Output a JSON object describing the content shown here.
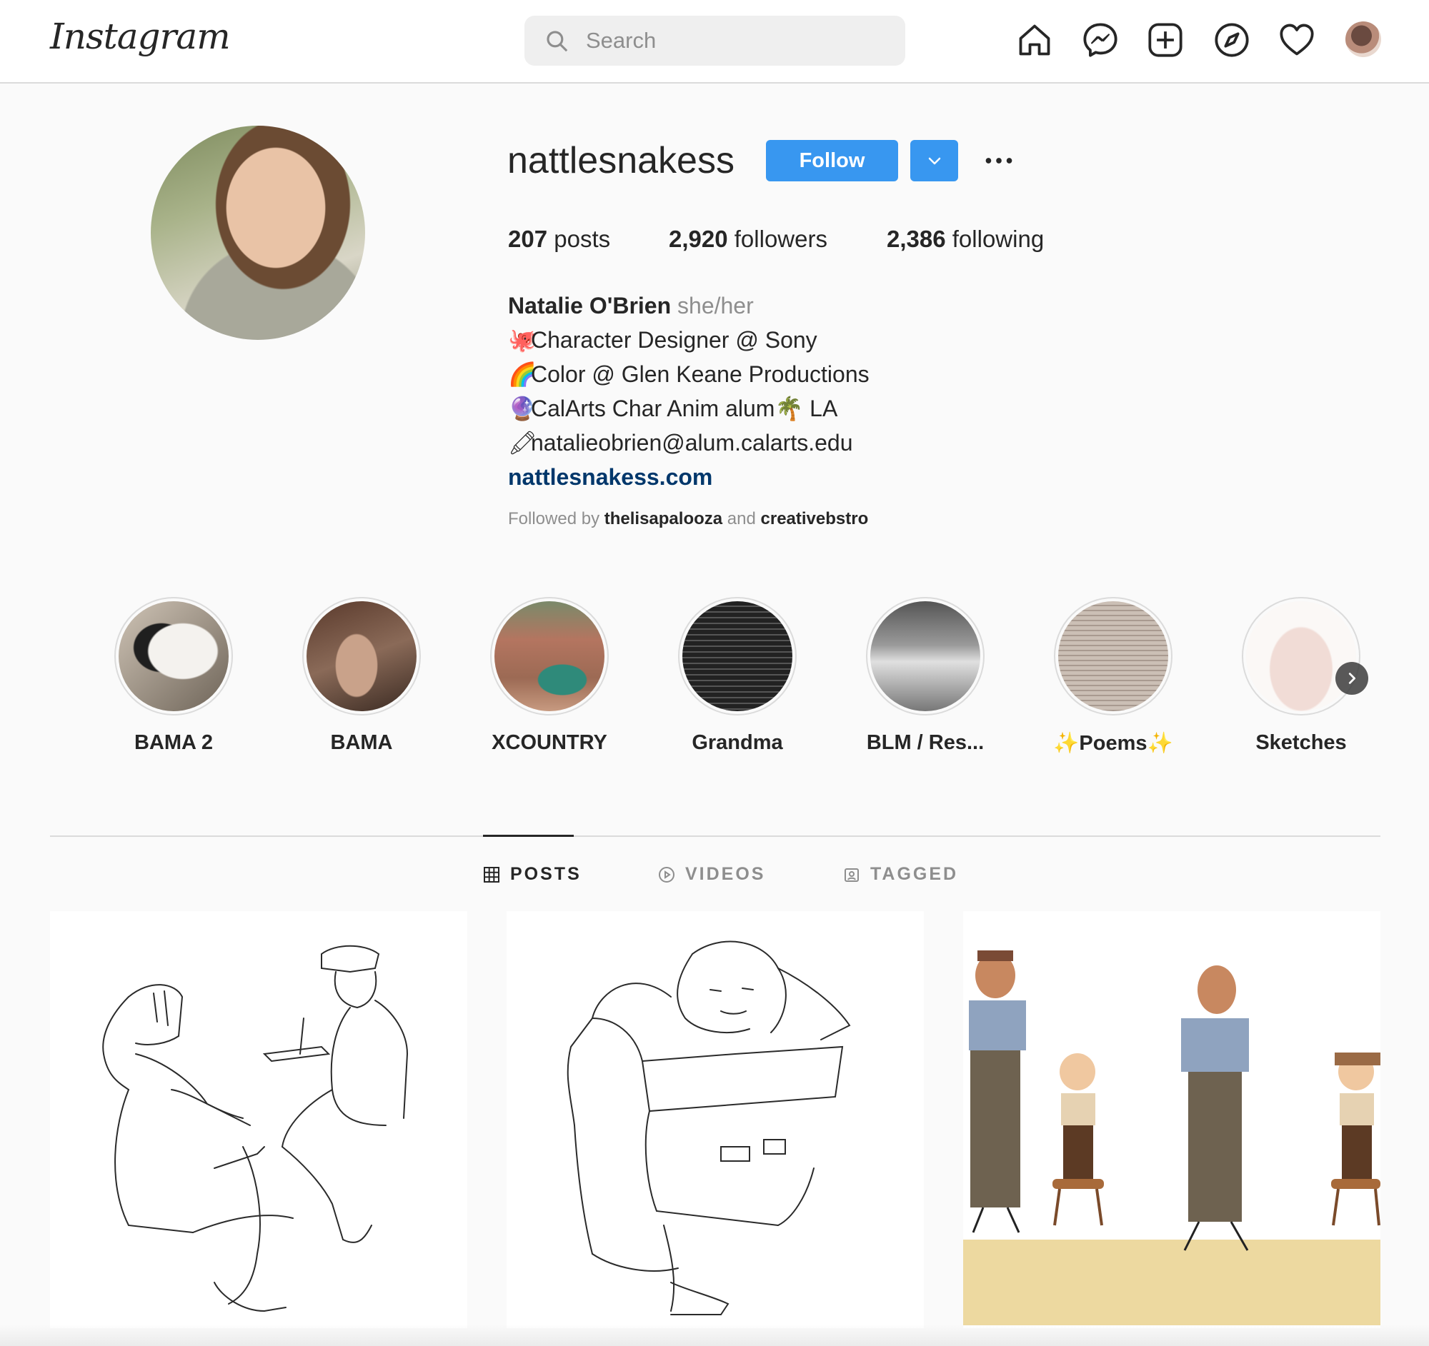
{
  "topbar": {
    "logo": "Instagram",
    "search": {
      "placeholder": "Search"
    },
    "icons": [
      "home-icon",
      "messenger-icon",
      "new-post-icon",
      "explore-icon",
      "activity-heart-icon"
    ]
  },
  "profile": {
    "username": "nattlesnakess",
    "follow_label": "Follow",
    "stats": {
      "posts": "207",
      "posts_label": "posts",
      "followers": "2,920",
      "followers_label": "followers",
      "following": "2,386",
      "following_label": "following"
    },
    "bio": {
      "name": "Natalie O'Brien",
      "pronouns": "she/her",
      "lines": [
        {
          "emoji": "🐙",
          "text": "Character Designer @ Sony"
        },
        {
          "emoji": "🌈",
          "text": "Color @ Glen Keane Productions"
        },
        {
          "emoji": "🔮",
          "text": "CalArts Char Anim alum🌴 LA"
        },
        {
          "emoji": "🖍",
          "text": "natalieobrien@alum.calarts.edu"
        }
      ],
      "website": "nattlesnakess.com"
    },
    "followed_by": {
      "prefix": "Followed by",
      "user1": "thelisapalooza",
      "and": "and",
      "user2": "creativebstro"
    }
  },
  "highlights": [
    {
      "label": "BAMA 2"
    },
    {
      "label": "BAMA"
    },
    {
      "label": "XCOUNTRY"
    },
    {
      "label": "Grandma"
    },
    {
      "label": "BLM / Res..."
    },
    {
      "label": "✨Poems✨"
    },
    {
      "label": "Sketches"
    }
  ],
  "tabs": [
    {
      "label": "POSTS",
      "active": true
    },
    {
      "label": "VIDEOS",
      "active": false
    },
    {
      "label": "TAGGED",
      "active": false
    }
  ],
  "colors": {
    "accent": "#3897f0",
    "link": "#00376b",
    "muted": "#8e8e8e",
    "text": "#262626"
  }
}
